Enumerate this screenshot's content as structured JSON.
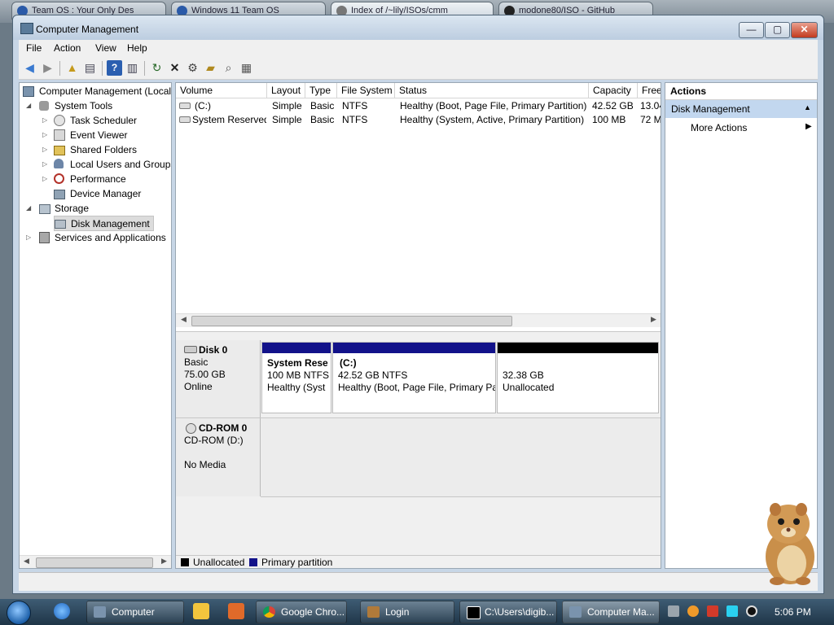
{
  "browser_tabs": [
    "Team OS : Your Only Des",
    "Windows 11 Team OS",
    "Index of /~lily/ISOs/cmm",
    "modone80/ISO - GitHub"
  ],
  "window": {
    "title": "Computer Management",
    "min": "—",
    "max": "▢",
    "close": "✕"
  },
  "menu": [
    "File",
    "Action",
    "View",
    "Help"
  ],
  "tree": {
    "root": "Computer Management (Local",
    "system_tools": "System Tools",
    "task_scheduler": "Task Scheduler",
    "event_viewer": "Event Viewer",
    "shared_folders": "Shared Folders",
    "local_users": "Local Users and Groups",
    "performance": "Performance",
    "device_manager": "Device Manager",
    "storage": "Storage",
    "disk_management": "Disk Management",
    "services": "Services and Applications"
  },
  "columns": [
    "Volume",
    "Layout",
    "Type",
    "File System",
    "Status",
    "Capacity",
    "Free"
  ],
  "volumes": [
    {
      "volume": "(C:)",
      "layout": "Simple",
      "type": "Basic",
      "fs": "NTFS",
      "status": "Healthy (Boot, Page File, Primary Partition)",
      "capacity": "42.52 GB",
      "free": "13.04"
    },
    {
      "volume": "System Reserved",
      "layout": "Simple",
      "type": "Basic",
      "fs": "NTFS",
      "status": "Healthy (System, Active, Primary Partition)",
      "capacity": "100 MB",
      "free": "72 M"
    }
  ],
  "disk0": {
    "name": "Disk 0",
    "type": "Basic",
    "size": "75.00 GB",
    "state": "Online",
    "partitions": [
      {
        "title": "System Rese",
        "line2": "100 MB NTFS",
        "line3": "Healthy (Syst"
      },
      {
        "title": "(C:)",
        "line2": "42.52 GB NTFS",
        "line3": "Healthy (Boot, Page File, Primary Pa"
      },
      {
        "title": "",
        "line2": "32.38 GB",
        "line3": "Unallocated"
      }
    ]
  },
  "cdrom": {
    "name": "CD-ROM 0",
    "type": "CD-ROM (D:)",
    "state": "No Media"
  },
  "legend": {
    "unallocated": "Unallocated",
    "primary": "Primary partition"
  },
  "colors": {
    "primary": "#12128a",
    "unallocated": "#000000",
    "selected": "#c2d7ef"
  },
  "actions": {
    "header": "Actions",
    "section": "Disk Management",
    "more": "More Actions"
  },
  "taskbar": {
    "items": [
      "Computer",
      "Google Chro...",
      "Login",
      "C:\\Users\\digib...",
      "Computer Ma..."
    ],
    "clock": "5:06 PM"
  }
}
